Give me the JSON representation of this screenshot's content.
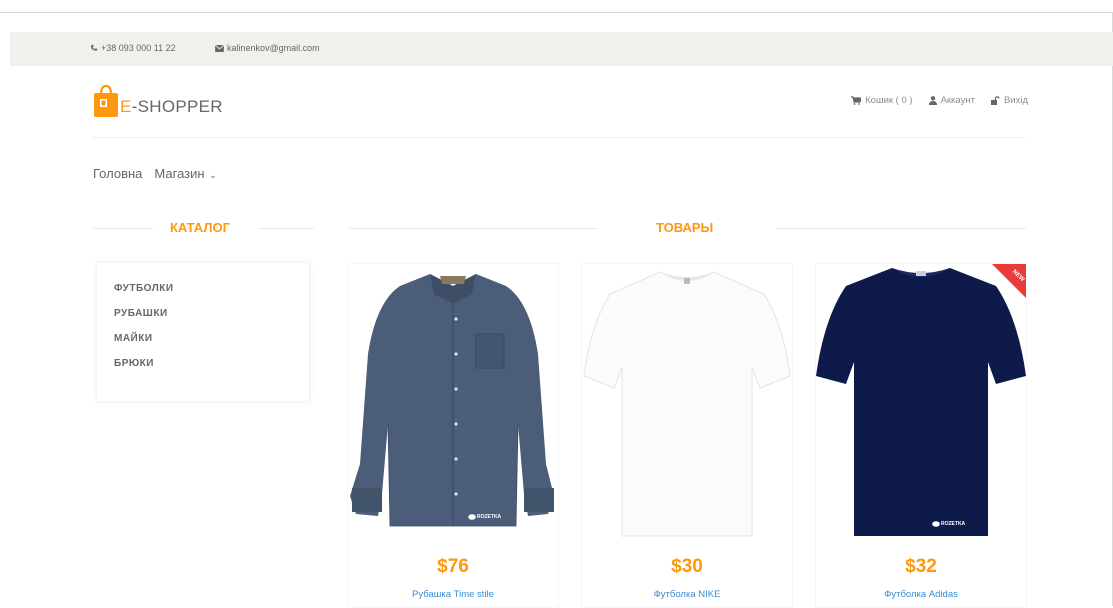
{
  "contacts": {
    "phone": "+38 093 000 11 22",
    "email": "kalinenkov@gmail.com"
  },
  "logo": {
    "prefix": "E",
    "rest": "-SHOPPER"
  },
  "usermenu": {
    "cart": "Кошик ( 0 )",
    "account": "Аккаунт",
    "logout": "Вихід"
  },
  "nav": {
    "home": "Головна",
    "shop": "Магазин"
  },
  "catalog": {
    "title": "КАТАЛОГ",
    "items": [
      "ФУТБОЛКИ",
      "РУБАШКИ",
      "МАЙКИ",
      "БРЮКИ"
    ]
  },
  "products": {
    "title": "ТОВАРЫ",
    "items": [
      {
        "price": "$76",
        "name": "Рубашка Time stile"
      },
      {
        "price": "$30",
        "name": "Футболка NIKE"
      },
      {
        "price": "$32",
        "name": "Футболка Adidas",
        "badge": "NEW"
      }
    ],
    "watermark": "ROZETKA"
  },
  "colors": {
    "accent": "#fe980f",
    "link": "#3a8bd6",
    "topbar": "#f0f0ed",
    "shirt": "#4b5d78",
    "navy_tee": "#0d1a4a",
    "badge": "#e83b3b"
  }
}
